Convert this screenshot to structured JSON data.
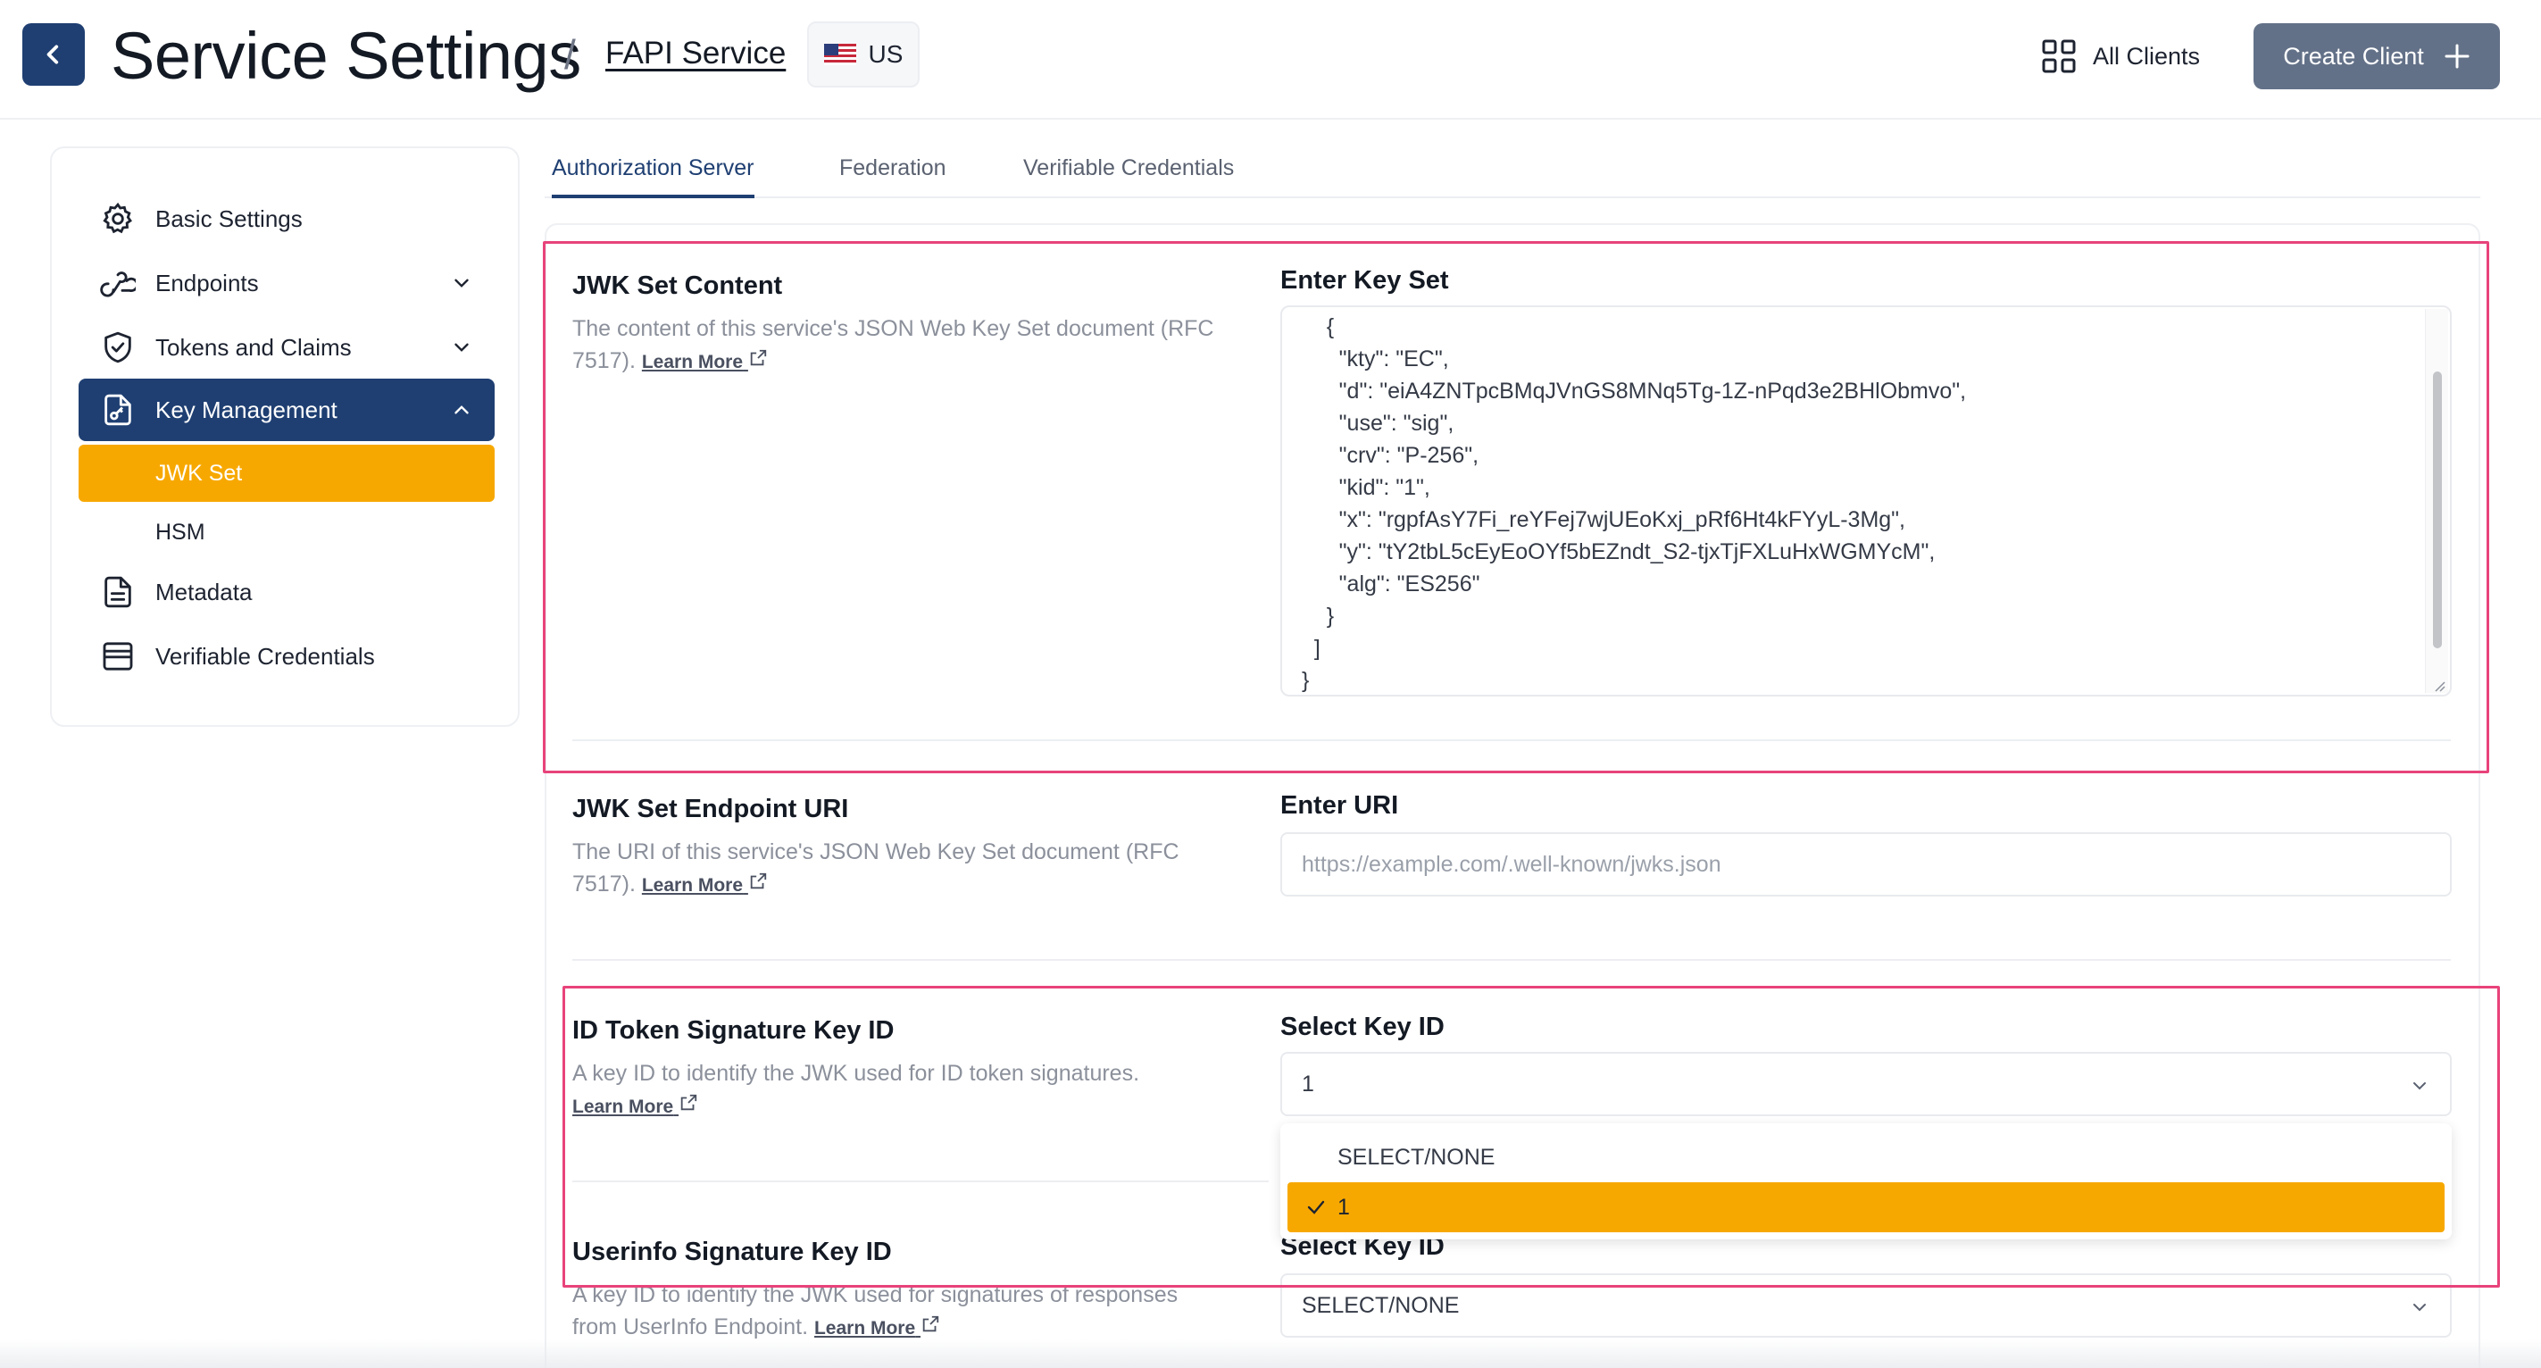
{
  "header": {
    "title": "Service Settings",
    "separator": "/",
    "service_name": "FAPI Service",
    "region": "US",
    "all_clients_label": "All Clients",
    "create_client_label": "Create Client"
  },
  "sidebar": {
    "items": [
      {
        "label": "Basic Settings"
      },
      {
        "label": "Endpoints"
      },
      {
        "label": "Tokens and Claims"
      },
      {
        "label": "Key Management"
      },
      {
        "label": "Metadata"
      },
      {
        "label": "Verifiable Credentials"
      }
    ],
    "sub_items": [
      {
        "label": "JWK Set",
        "selected": true
      },
      {
        "label": "HSM"
      }
    ]
  },
  "tabs": [
    {
      "label": "Authorization Server",
      "active": true
    },
    {
      "label": "Federation"
    },
    {
      "label": "Verifiable Credentials"
    }
  ],
  "sections": {
    "jwk_content": {
      "title": "JWK Set Content",
      "description": "The content of this service's JSON Web Key Set document (RFC 7517).",
      "learn_more": "Learn More",
      "field_label": "Enter Key Set",
      "value": "    {\n      \"kty\": \"EC\",\n      \"d\": \"eiA4ZNTpcBMqJVnGS8MNq5Tg-1Z-nPqd3e2BHlObmvo\",\n      \"use\": \"sig\",\n      \"crv\": \"P-256\",\n      \"kid\": \"1\",\n      \"x\": \"rgpfAsY7Fi_reYFej7wjUEoKxj_pRf6Ht4kFYyL-3Mg\",\n      \"y\": \"tY2tbL5cEyEoOYf5bEZndt_S2-tjxTjFXLuHxWGMYcM\",\n      \"alg\": \"ES256\"\n    }\n  ]\n}"
    },
    "jwk_uri": {
      "title": "JWK Set Endpoint URI",
      "description": "The URI of this service's JSON Web Key Set document (RFC 7517).",
      "learn_more": "Learn More",
      "field_label": "Enter URI",
      "placeholder": "https://example.com/.well-known/jwks.json"
    },
    "id_token_key": {
      "title": "ID Token Signature Key ID",
      "description": "A key ID to identify the JWK used for ID token signatures.",
      "learn_more": "Learn More",
      "field_label": "Select Key ID",
      "value": "1",
      "options": [
        "SELECT/NONE",
        "1"
      ]
    },
    "userinfo_key": {
      "title": "Userinfo Signature Key ID",
      "description": "A key ID to identify the JWK used for signatures of responses from UserInfo Endpoint.",
      "learn_more": "Learn More",
      "field_label": "Select Key ID",
      "value": "SELECT/NONE"
    }
  },
  "colors": {
    "primary": "#1f3f72",
    "accent": "#f7a800",
    "button": "#637188",
    "highlight": "#e8437a"
  }
}
